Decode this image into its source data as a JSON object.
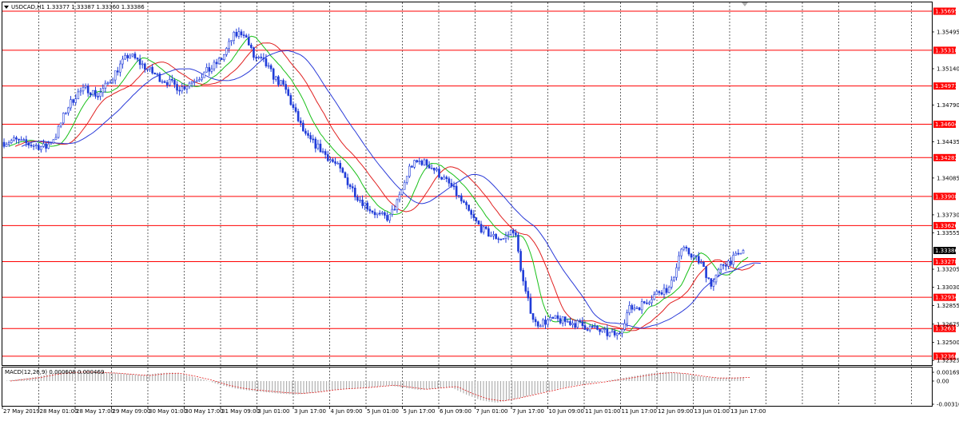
{
  "header": {
    "symbol_menu_arrow": "triangle-down-icon",
    "title": "USDCAD,H1  1.33377 1.33387 1.33360 1.33386"
  },
  "macd": {
    "label": "MACD(12,26,9) 0.000608 0.000469"
  },
  "colors": {
    "background": "#ffffff",
    "candles": "#1f3bd8",
    "ma_fast": "#19c019",
    "ma_mid": "#e02020",
    "ma_slow": "#2a3ad8",
    "level_line": "#ff0000",
    "level_label_bg": "#ff0000",
    "current_label_bg": "#000000",
    "grid": "#b8b8b8",
    "macd_hist": "#b0b0b0",
    "macd_signal": "#e02020"
  },
  "chart_data": {
    "type": "candlestick",
    "price_axis_ticks": [
      "1.35870",
      "1.35495",
      "1.35140",
      "1.34790",
      "1.34435",
      "1.34085",
      "1.33730",
      "1.33555",
      "1.33205",
      "1.33030",
      "1.32855",
      "1.32675",
      "1.32500",
      "1.32325"
    ],
    "ylim": [
      1.3228,
      1.3578
    ],
    "horizontal_levels": [
      "1.35695",
      "1.35318",
      "1.34973",
      "1.34604",
      "1.34282",
      "1.33908",
      "1.33626",
      "1.33278",
      "1.32934",
      "1.32633",
      "1.32366"
    ],
    "current_price": "1.33386",
    "time_labels": [
      "27 May 2019",
      "28 May 01:00",
      "28 May 17:00",
      "29 May 09:00",
      "30 May 01:00",
      "30 May 17:00",
      "31 May 09:00",
      "3 Jun 01:00",
      "3 Jun 17:00",
      "4 Jun 09:00",
      "5 Jun 01:00",
      "5 Jun 17:00",
      "6 Jun 09:00",
      "7 Jun 01:00",
      "7 Jun 17:00",
      "10 Jun 09:00",
      "11 Jun 01:00",
      "11 Jun 17:00",
      "12 Jun 09:00",
      "13 Jun 01:00",
      "13 Jun 17:00"
    ],
    "price_path": [
      1.3443,
      1.3445,
      1.3442,
      1.344,
      1.3438,
      1.345,
      1.3475,
      1.349,
      1.3495,
      1.3488,
      1.35,
      1.3515,
      1.3528,
      1.352,
      1.3512,
      1.3505,
      1.35,
      1.3495,
      1.3502,
      1.3508,
      1.3515,
      1.3525,
      1.3545,
      1.355,
      1.3525,
      1.352,
      1.3505,
      1.3495,
      1.347,
      1.3448,
      1.344,
      1.343,
      1.342,
      1.3405,
      1.339,
      1.338,
      1.3372,
      1.337,
      1.339,
      1.342,
      1.3425,
      1.342,
      1.341,
      1.34,
      1.3385,
      1.337,
      1.3358,
      1.3352,
      1.335,
      1.336,
      1.33,
      1.3268,
      1.327,
      1.3272,
      1.327,
      1.3268,
      1.3265,
      1.3262,
      1.3258,
      1.3257,
      1.3282,
      1.3285,
      1.3292,
      1.33,
      1.3302,
      1.334,
      1.3335,
      1.3325,
      1.3305,
      1.3325,
      1.333,
      1.3338
    ],
    "macd_ticks": [
      "0.001699",
      "0.00",
      "-0.003109"
    ],
    "macd_histogram": [
      0.0,
      0.0003,
      0.0006,
      0.0011,
      0.0014,
      0.0015,
      0.0014,
      0.0013,
      0.0011,
      0.0009,
      0.0012,
      0.0013,
      0.0008,
      0.0002,
      -0.0005,
      -0.001,
      -0.0013,
      -0.0015,
      -0.0017,
      -0.0018,
      -0.0016,
      -0.0013,
      -0.0011,
      -0.001,
      -0.0008,
      -0.0006,
      -0.0009,
      -0.0012,
      -0.001,
      -0.0008,
      -0.0018,
      -0.0026,
      -0.0029,
      -0.0025,
      -0.002,
      -0.0015,
      -0.001,
      -0.0006,
      -0.0003,
      0.0,
      0.0004,
      0.0008,
      0.0012,
      0.0014,
      0.0012,
      0.0008,
      0.0005,
      0.0005,
      0.0006
    ],
    "grid": true
  }
}
